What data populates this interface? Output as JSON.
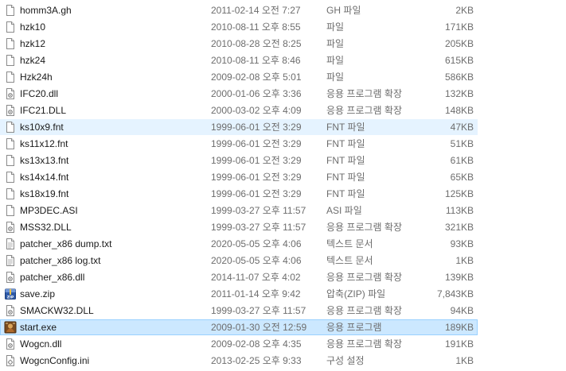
{
  "files": [
    {
      "name": "homm3A.gh",
      "date": "2011-02-14 오전 7:27",
      "type": "GH 파일",
      "size": "2KB",
      "icon": "file-icon"
    },
    {
      "name": "hzk10",
      "date": "2010-08-11 오후 8:55",
      "type": "파일",
      "size": "171KB",
      "icon": "file-icon"
    },
    {
      "name": "hzk12",
      "date": "2010-08-28 오전 8:25",
      "type": "파일",
      "size": "205KB",
      "icon": "file-icon"
    },
    {
      "name": "hzk24",
      "date": "2010-08-11 오후 8:46",
      "type": "파일",
      "size": "615KB",
      "icon": "file-icon"
    },
    {
      "name": "Hzk24h",
      "date": "2009-02-08 오후 5:01",
      "type": "파일",
      "size": "586KB",
      "icon": "file-icon"
    },
    {
      "name": "IFC20.dll",
      "date": "2000-01-06 오후 3:36",
      "type": "응용 프로그램 확장",
      "size": "132KB",
      "icon": "dll-icon"
    },
    {
      "name": "IFC21.DLL",
      "date": "2000-03-02 오후 4:09",
      "type": "응용 프로그램 확장",
      "size": "148KB",
      "icon": "dll-icon"
    },
    {
      "name": "ks10x9.fnt",
      "date": "1999-06-01 오전 3:29",
      "type": "FNT 파일",
      "size": "47KB",
      "icon": "file-icon"
    },
    {
      "name": "ks11x12.fnt",
      "date": "1999-06-01 오전 3:29",
      "type": "FNT 파일",
      "size": "51KB",
      "icon": "file-icon"
    },
    {
      "name": "ks13x13.fnt",
      "date": "1999-06-01 오전 3:29",
      "type": "FNT 파일",
      "size": "61KB",
      "icon": "file-icon"
    },
    {
      "name": "ks14x14.fnt",
      "date": "1999-06-01 오전 3:29",
      "type": "FNT 파일",
      "size": "65KB",
      "icon": "file-icon"
    },
    {
      "name": "ks18x19.fnt",
      "date": "1999-06-01 오전 3:29",
      "type": "FNT 파일",
      "size": "125KB",
      "icon": "file-icon"
    },
    {
      "name": "MP3DEC.ASI",
      "date": "1999-03-27 오후 11:57",
      "type": "ASI 파일",
      "size": "113KB",
      "icon": "file-icon"
    },
    {
      "name": "MSS32.DLL",
      "date": "1999-03-27 오후 11:57",
      "type": "응용 프로그램 확장",
      "size": "321KB",
      "icon": "dll-icon"
    },
    {
      "name": "patcher_x86 dump.txt",
      "date": "2020-05-05 오후 4:06",
      "type": "텍스트 문서",
      "size": "93KB",
      "icon": "text-file-icon"
    },
    {
      "name": "patcher_x86 log.txt",
      "date": "2020-05-05 오후 4:06",
      "type": "텍스트 문서",
      "size": "1KB",
      "icon": "text-file-icon"
    },
    {
      "name": "patcher_x86.dll",
      "date": "2014-11-07 오후 4:02",
      "type": "응용 프로그램 확장",
      "size": "139KB",
      "icon": "dll-icon"
    },
    {
      "name": "save.zip",
      "date": "2011-01-14 오후 9:42",
      "type": "압축(ZIP) 파일",
      "size": "7,843KB",
      "icon": "zip-icon"
    },
    {
      "name": "SMACKW32.DLL",
      "date": "1999-03-27 오후 11:57",
      "type": "응용 프로그램 확장",
      "size": "94KB",
      "icon": "dll-icon"
    },
    {
      "name": "start.exe",
      "date": "2009-01-30 오전 12:59",
      "type": "응용 프로그램",
      "size": "189KB",
      "icon": "exe-icon"
    },
    {
      "name": "Wogcn.dll",
      "date": "2009-02-08 오후 4:35",
      "type": "응용 프로그램 확장",
      "size": "191KB",
      "icon": "dll-icon"
    },
    {
      "name": "WogcnConfig.ini",
      "date": "2013-02-25 오후 9:33",
      "type": "구성 설정",
      "size": "1KB",
      "icon": "config-file-icon"
    }
  ],
  "hover_index": 7,
  "selected_index": 19,
  "colors": {
    "hover": "#e5f3ff",
    "selected": "#cce8ff",
    "selected_border": "#99d1ff",
    "secondary_text": "#6d6d6d"
  }
}
